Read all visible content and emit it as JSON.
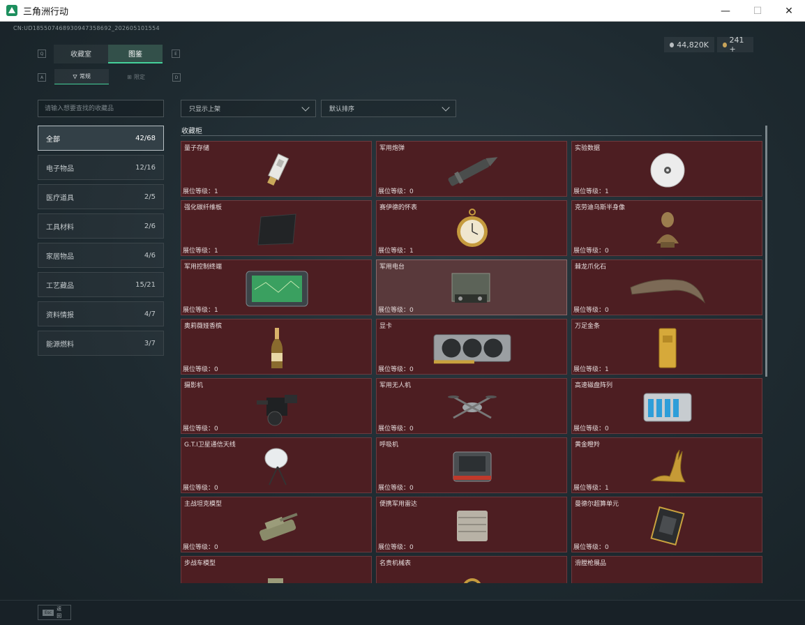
{
  "window": {
    "title": "三角洲行动",
    "minimize": "—",
    "maximize": "☐",
    "close": "✕"
  },
  "uid": "CN:UD185507468930947358692_202605101554",
  "currency": [
    {
      "icon": "silver-coin-icon",
      "value": "44,820K"
    },
    {
      "icon": "gold-coin-icon",
      "value": "241 +"
    }
  ],
  "key_hints": {
    "tabs_left": "Q",
    "tabs_right": "E",
    "sub_left": "A",
    "sub_right": "D"
  },
  "tabs": [
    {
      "label": "收藏室",
      "active": false
    },
    {
      "label": "图鉴",
      "active": true
    }
  ],
  "subtabs": [
    {
      "label": "常规",
      "icon": "bottle-icon",
      "active": true
    },
    {
      "label": "限定",
      "icon": "grid-icon",
      "active": false
    }
  ],
  "search": {
    "placeholder": "请输入想要查找的收藏品"
  },
  "categories": [
    {
      "label": "全部",
      "count": "42/68",
      "active": true
    },
    {
      "label": "电子物品",
      "count": "12/16"
    },
    {
      "label": "医疗道具",
      "count": "2/5"
    },
    {
      "label": "工具材料",
      "count": "2/6"
    },
    {
      "label": "家居物品",
      "count": "4/6"
    },
    {
      "label": "工艺藏品",
      "count": "15/21"
    },
    {
      "label": "资料情报",
      "count": "4/7"
    },
    {
      "label": "能源燃料",
      "count": "3/7"
    }
  ],
  "filters": {
    "shelf": "只显示上架",
    "sort": "默认排序"
  },
  "section_title": "收藏柜",
  "level_label": "展位等级：",
  "items": [
    {
      "name": "量子存储",
      "level": "1",
      "icon": "usb-drive-icon"
    },
    {
      "name": "军用炮弹",
      "level": "0",
      "icon": "artillery-shell-icon"
    },
    {
      "name": "实验数据",
      "level": "1",
      "icon": "disc-icon"
    },
    {
      "name": "强化碳纤维板",
      "level": "1",
      "icon": "carbon-plate-icon"
    },
    {
      "name": "赛伊德的怀表",
      "level": "1",
      "icon": "pocket-watch-icon"
    },
    {
      "name": "克劳迪乌斯半身像",
      "level": "0",
      "icon": "bust-icon"
    },
    {
      "name": "军用控制终端",
      "level": "1",
      "icon": "control-terminal-icon"
    },
    {
      "name": "军用电台",
      "level": "0",
      "icon": "radio-icon",
      "highlight": true
    },
    {
      "name": "棘龙爪化石",
      "level": "0",
      "icon": "claw-fossil-icon"
    },
    {
      "name": "奥莉薇娅香槟",
      "level": "0",
      "icon": "champagne-icon"
    },
    {
      "name": "显卡",
      "level": "0",
      "icon": "graphics-card-icon"
    },
    {
      "name": "万足金条",
      "level": "1",
      "icon": "gold-bar-icon"
    },
    {
      "name": "摄影机",
      "level": "0",
      "icon": "camera-icon"
    },
    {
      "name": "军用无人机",
      "level": "0",
      "icon": "drone-icon"
    },
    {
      "name": "高速磁盘阵列",
      "level": "0",
      "icon": "disk-array-icon"
    },
    {
      "name": "G.T.I卫星通信天线",
      "level": "0",
      "icon": "satellite-dish-icon"
    },
    {
      "name": "呼吸机",
      "level": "0",
      "icon": "ventilator-icon"
    },
    {
      "name": "黄金瞪羚",
      "level": "1",
      "icon": "gold-gazelle-icon"
    },
    {
      "name": "主战坦克模型",
      "level": "0",
      "icon": "tank-model-icon"
    },
    {
      "name": "便携军用雷达",
      "level": "0",
      "icon": "radar-icon"
    },
    {
      "name": "曼德尔超算单元",
      "level": "0",
      "icon": "supercomputer-unit-icon"
    },
    {
      "name": "步战车模型",
      "level": "",
      "icon": "ifv-model-icon"
    },
    {
      "name": "名贵机械表",
      "level": "",
      "icon": "wristwatch-icon"
    },
    {
      "name": "滑膛枪展品",
      "level": "",
      "icon": "musket-icon"
    }
  ],
  "footer": {
    "key": "Esc",
    "label": "返回"
  }
}
